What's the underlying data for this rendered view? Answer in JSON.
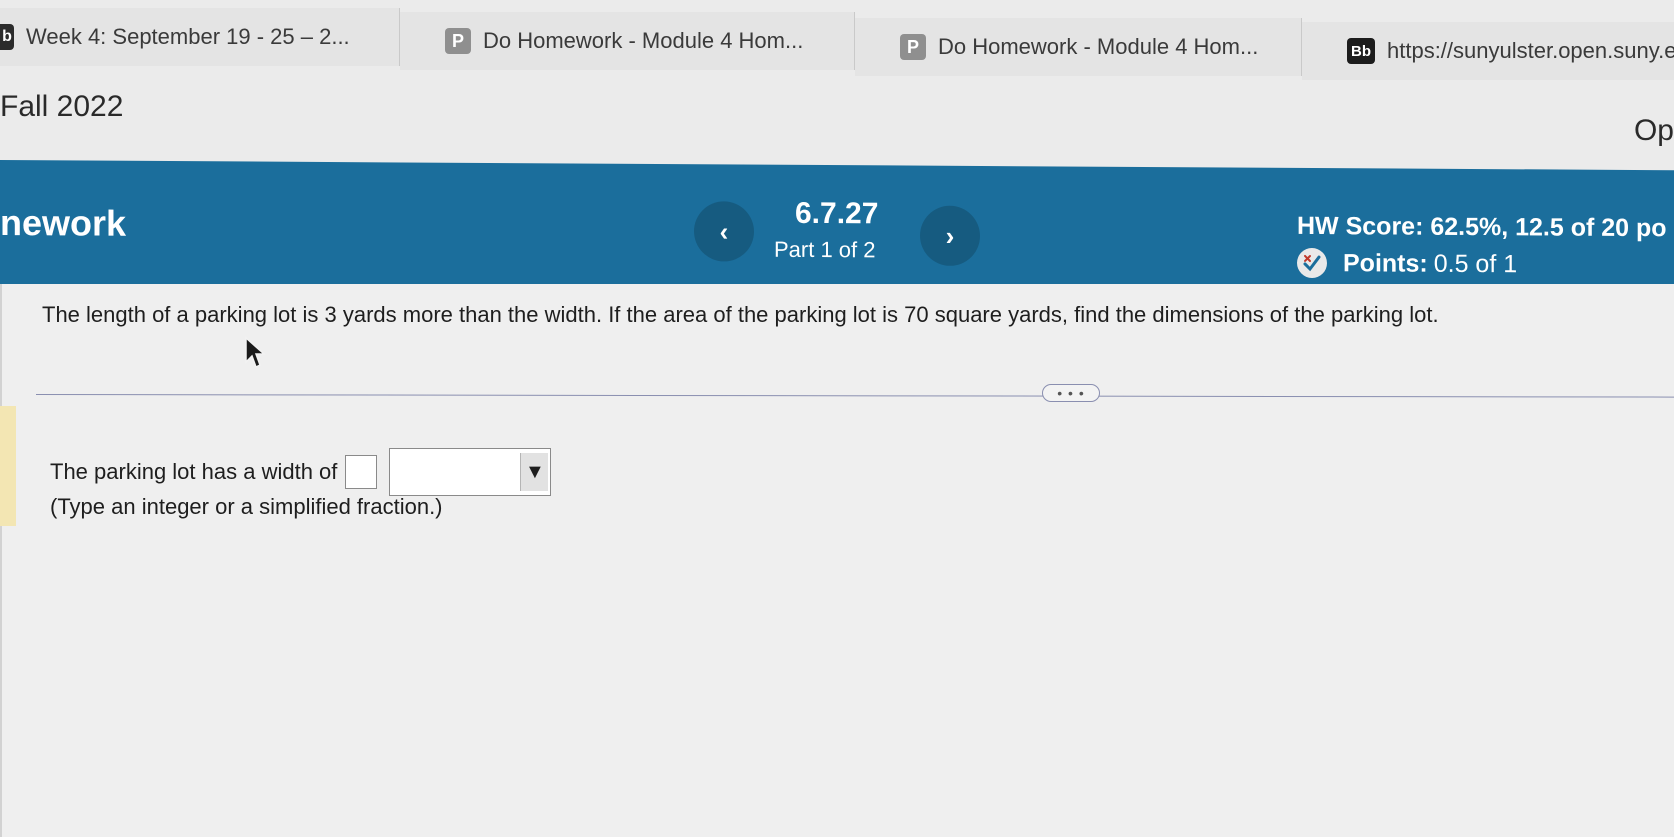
{
  "tabs": [
    {
      "icon": "b",
      "label": "Week 4: September 19 - 25 – 2..."
    },
    {
      "icon": "P",
      "label": "Do Homework - Module 4 Hom..."
    },
    {
      "icon": "P",
      "label": "Do Homework - Module 4 Hom..."
    },
    {
      "icon": "Bb",
      "label": "https://sunyulster.open.suny.ed"
    }
  ],
  "course": {
    "title": "Fall 2022",
    "options_partial": "Op"
  },
  "hw_bar": {
    "label": "nework",
    "question_number": "6.7.27",
    "part": "Part 1 of 2",
    "prev_glyph": "‹",
    "next_glyph": "›",
    "hw_score": "HW Score: 62.5%, 12.5 of 20 po",
    "points_label": "Points:",
    "points_value": "0.5 of 1"
  },
  "question": {
    "text": "The length of a parking lot is 3 yards more than the width. If the area of the parking lot is 70 square yards, find the dimensions of the parking lot.",
    "more_glyph": "• • •",
    "answer_prefix": "The parking lot has a width of",
    "width_value": "",
    "unit_value": "",
    "dropdown_glyph": "▼",
    "hint": "(Type an integer or a simplified fraction.)"
  },
  "colors": {
    "hw_bar_bg": "#1b6e9c",
    "nav_btn_bg": "#165b80"
  }
}
